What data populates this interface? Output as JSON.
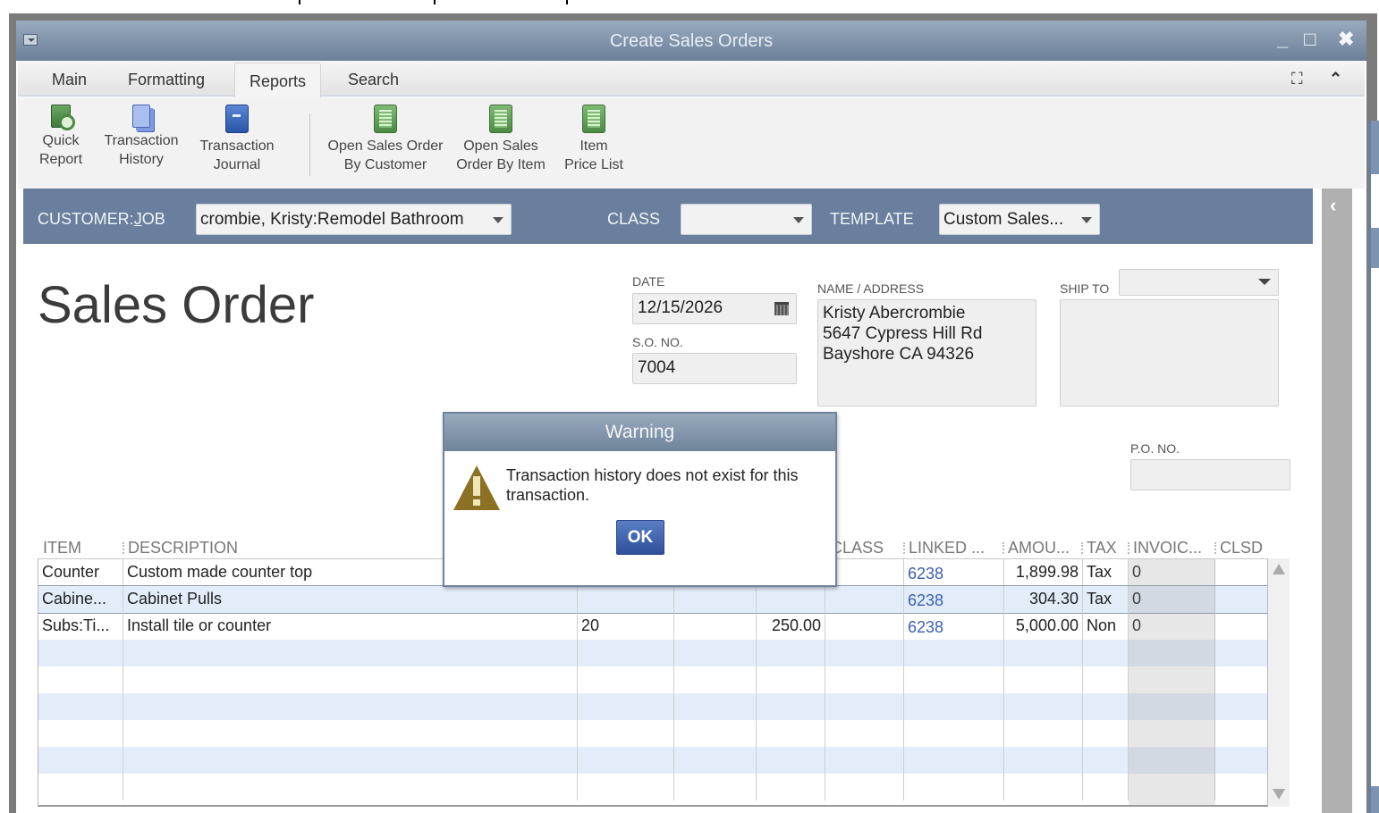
{
  "window": {
    "title": "Create Sales Orders",
    "minimize_glyph": "_",
    "maximize_glyph": "□",
    "close_glyph": "✖"
  },
  "tabs": [
    {
      "label": "Main",
      "active": false
    },
    {
      "label": "Formatting",
      "active": false
    },
    {
      "label": "Reports",
      "active": true
    },
    {
      "label": "Search",
      "active": false
    }
  ],
  "tab_actions": {
    "expand_glyph": "⛶",
    "collapse_glyph": "⌃"
  },
  "ribbon": {
    "buttons": [
      {
        "line1": "Quick",
        "line2": "Report",
        "icon": "quick-report-icon"
      },
      {
        "line1": "Transaction",
        "line2": "History",
        "icon": "transaction-history-icon"
      },
      {
        "line1": "Transaction",
        "line2": "Journal",
        "icon": "transaction-journal-icon"
      },
      {
        "line1": "Open Sales Order",
        "line2": "By Customer",
        "icon": "report-sheet-icon"
      },
      {
        "line1": "Open Sales",
        "line2": "Order By Item",
        "icon": "report-sheet-icon"
      },
      {
        "line1": "Item",
        "line2": "Price List",
        "icon": "price-list-icon"
      }
    ]
  },
  "header_bar": {
    "customer_job_label_pre": "CUSTOMER:",
    "customer_job_label_u": "J",
    "customer_job_label_post": "OB",
    "customer_job_value": "crombie, Kristy:Remodel Bathroom",
    "class_label": "CLASS",
    "class_value": "",
    "template_label": "TEMPLATE",
    "template_value": "Custom Sales..."
  },
  "side_panel": {
    "toggle_glyph": "‹"
  },
  "form": {
    "title": "Sales Order",
    "date_label": "DATE",
    "date_value": "12/15/2026",
    "so_no_label": "S.O. NO.",
    "so_no_value": "7004",
    "name_address_label": "NAME / ADDRESS",
    "name_address_lines": [
      "Kristy Abercrombie",
      "5647 Cypress Hill Rd",
      "Bayshore CA 94326"
    ],
    "ship_to_label": "SHIP TO",
    "ship_to_value": "",
    "po_no_label": "P.O. NO.",
    "po_no_value": ""
  },
  "table": {
    "columns": [
      "ITEM",
      "DESCRIPTION",
      "",
      "",
      "",
      "CLASS",
      "LINKED ...",
      "AMOU...",
      "TAX",
      "INVOIC...",
      "CLSD"
    ],
    "rows": [
      {
        "item": "Counter",
        "description": "Custom made counter top",
        "qty": "",
        "um": "",
        "rate": "",
        "class": "",
        "linked": "6238",
        "amount": "1,899.98",
        "tax": "Tax",
        "invoiced": "0",
        "clsd": ""
      },
      {
        "item": "Cabine...",
        "description": "Cabinet Pulls",
        "qty": "",
        "um": "",
        "rate": "",
        "class": "",
        "linked": "6238",
        "amount": "304.30",
        "tax": "Tax",
        "invoiced": "0",
        "clsd": ""
      },
      {
        "item": "Subs:Ti...",
        "description": "Install tile or counter",
        "qty": "20",
        "um": "",
        "rate": "250.00",
        "class": "",
        "linked": "6238",
        "amount": "5,000.00",
        "tax": "Non",
        "invoiced": "0",
        "clsd": ""
      }
    ],
    "selected_row": 1,
    "link_color": "#3c5fb0"
  },
  "dialog": {
    "title": "Warning",
    "message": "Transaction history does not exist for this transaction.",
    "ok_label": "OK",
    "icon": "warning-icon"
  },
  "colors": {
    "titlebar": "#6c8099",
    "header_bar": "#6a7f9d",
    "ok_button": "#2e4f9a",
    "warning_icon": "#8c7124",
    "row_alt": "#e3edfa"
  }
}
